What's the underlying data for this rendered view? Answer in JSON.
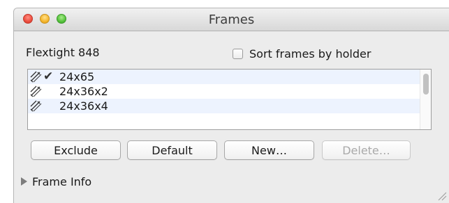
{
  "window": {
    "title": "Frames",
    "controls": [
      "close-button",
      "minimize-button",
      "zoom-button"
    ]
  },
  "device": {
    "name": "Flextight 848"
  },
  "sort": {
    "label": "Sort frames by holder",
    "checked": false
  },
  "frames": {
    "items": [
      {
        "label": "24x65",
        "selected": true,
        "icon": "holder-icon"
      },
      {
        "label": "24x36x2",
        "selected": false,
        "icon": "holder-icon"
      },
      {
        "label": "24x36x4",
        "selected": false,
        "icon": "holder-icon"
      }
    ]
  },
  "buttons": {
    "exclude": "Exclude",
    "default": "Default",
    "new": "New…",
    "delete": "Delete…"
  },
  "frame_info": {
    "label": "Frame Info",
    "expanded": false
  }
}
